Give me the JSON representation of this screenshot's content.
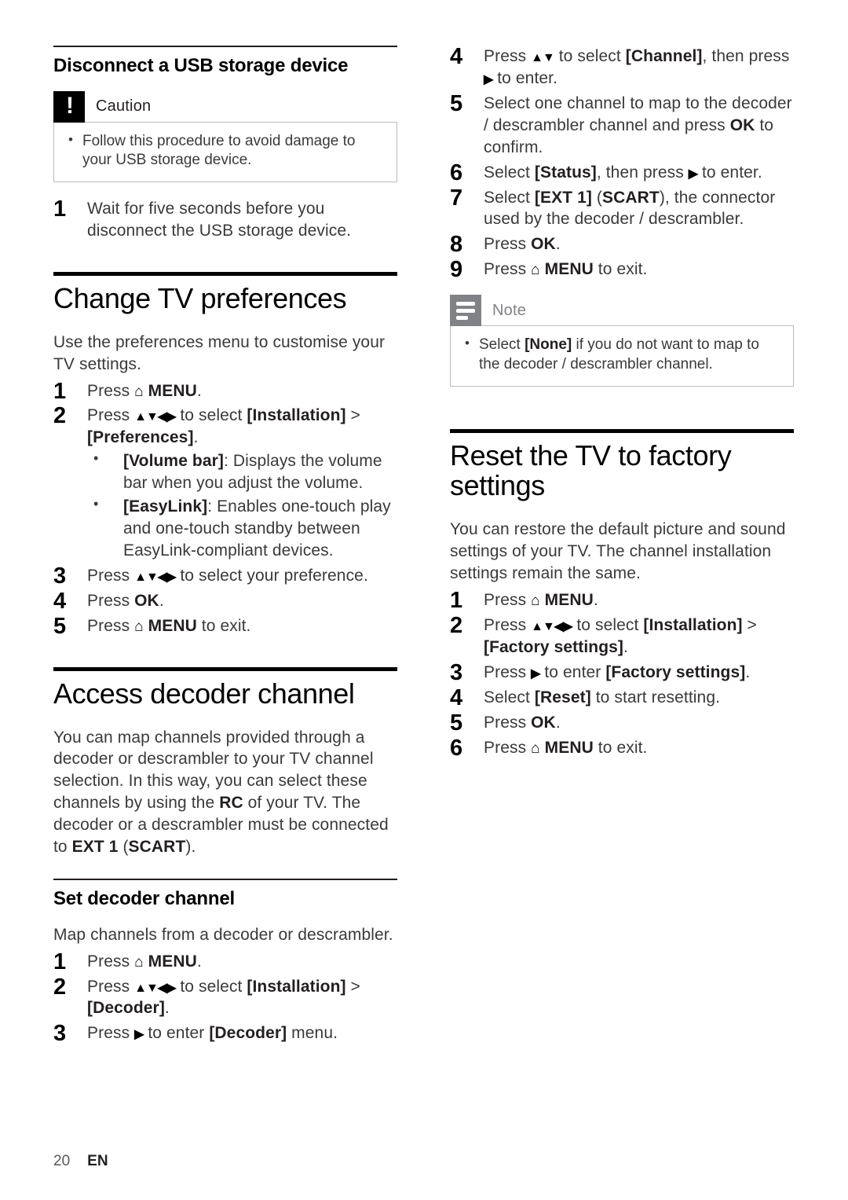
{
  "footer": {
    "page_number": "20",
    "language": "EN"
  },
  "icons": {
    "home": "⌂",
    "arrow_right": "▶",
    "arrow_up": "▲",
    "arrow_down": "▼",
    "arrow_left": "◀",
    "bullet": "•",
    "exclamation": "!"
  },
  "left_column": {
    "usb_section": {
      "heading": "Disconnect a USB storage device",
      "caution": {
        "label": "Caution",
        "items": [
          "Follow this procedure to avoid damage to your USB storage device."
        ]
      },
      "steps": [
        {
          "num": "1",
          "text": "Wait for five seconds before you disconnect the USB storage device."
        }
      ]
    },
    "preferences_section": {
      "heading": "Change TV preferences",
      "intro": "Use the preferences menu to customise your TV settings.",
      "steps": [
        {
          "num": "1",
          "text": "Press ⌂ MENU."
        },
        {
          "num": "2",
          "text": "Press ▲▼◀▶ to select [Installation] > [Preferences]."
        },
        {
          "num": "3",
          "text": "Press ▲▼◀▶ to select your preference."
        },
        {
          "num": "4",
          "text": "Press OK."
        },
        {
          "num": "5",
          "text": "Press ⌂ MENU to exit."
        }
      ],
      "sub_bullets": [
        {
          "term": "[Volume bar]",
          "desc": ": Displays the volume bar when you adjust the volume."
        },
        {
          "term": "[EasyLink]",
          "desc": ": Enables one-touch play and one-touch standby between EasyLink-compliant devices."
        }
      ]
    },
    "decoder_section": {
      "heading": "Access decoder channel",
      "intro": "You can map channels provided through a decoder or descrambler to your TV channel selection. In this way, you can select these channels by using the RC of your TV. The decoder or a descrambler must be connected to EXT 1 (SCART).",
      "subheading": "Set decoder channel",
      "sub_intro": "Map channels from a decoder or descrambler.",
      "steps": [
        {
          "num": "1",
          "text": "Press ⌂ MENU."
        },
        {
          "num": "2",
          "text": "Press ▲▼◀▶ to select [Installation] > [Decoder]."
        },
        {
          "num": "3",
          "text": "Press ▶ to enter [Decoder] menu."
        }
      ]
    }
  },
  "right_column": {
    "decoder_steps_continued": [
      {
        "num": "4",
        "text": "Press ▲▼ to select [Channel], then press ▶ to enter."
      },
      {
        "num": "5",
        "text": "Select one channel to map to the decoder / descrambler channel and press OK to confirm."
      },
      {
        "num": "6",
        "text": "Select [Status], then press ▶ to enter."
      },
      {
        "num": "7",
        "text": "Select [EXT 1] (SCART), the connector used by the decoder / descrambler."
      },
      {
        "num": "8",
        "text": "Press OK."
      },
      {
        "num": "9",
        "text": "Press ⌂ MENU to exit."
      }
    ],
    "note": {
      "label": "Note",
      "items": [
        "Select [None] if you do not want to map to the decoder / descrambler channel."
      ]
    },
    "factory_section": {
      "heading": "Reset the TV to factory settings",
      "intro": "You can restore the default picture and sound settings of your TV. The channel installation settings remain the same.",
      "steps": [
        {
          "num": "1",
          "text": "Press ⌂ MENU."
        },
        {
          "num": "2",
          "text": "Press ▲▼◀▶ to select [Installation] > [Factory settings]."
        },
        {
          "num": "3",
          "text": "Press ▶ to enter [Factory settings]."
        },
        {
          "num": "4",
          "text": "Select [Reset] to start resetting."
        },
        {
          "num": "5",
          "text": "Press OK."
        },
        {
          "num": "6",
          "text": "Press ⌂ MENU to exit."
        }
      ]
    }
  }
}
